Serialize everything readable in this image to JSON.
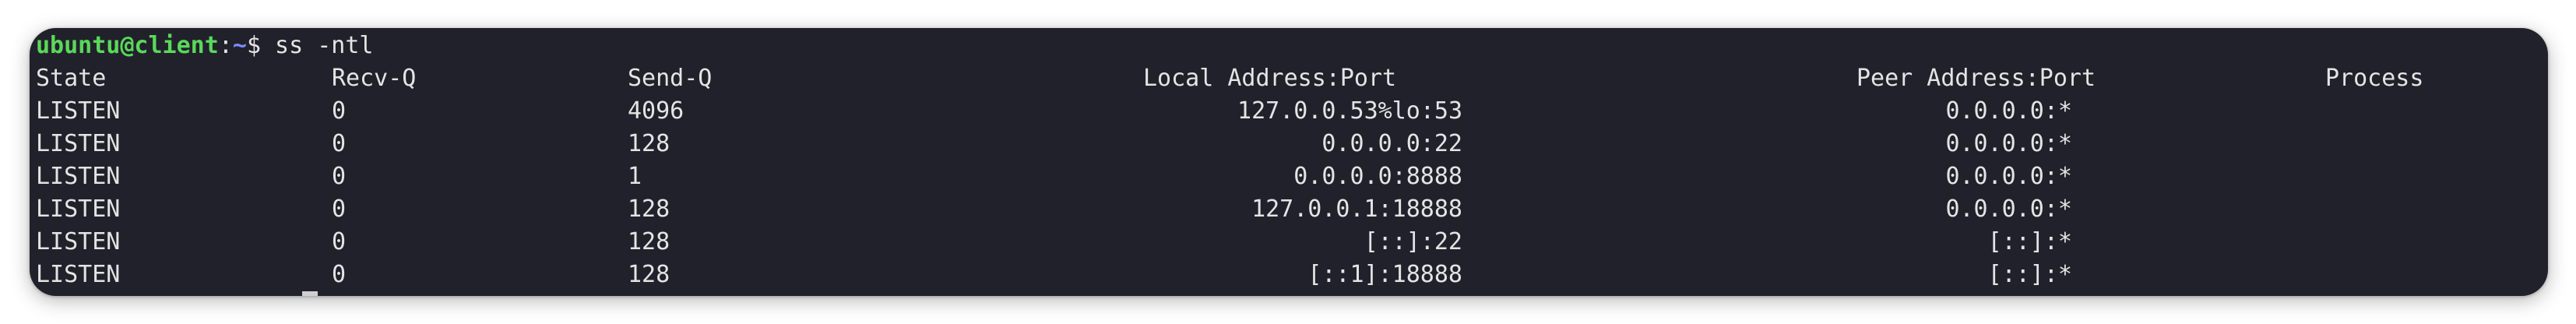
{
  "prompt": {
    "user_host": "ubuntu@client",
    "colon": ":",
    "path": "~",
    "dollar": "$",
    "command": " ss -ntl"
  },
  "table": {
    "headers": {
      "state": "State",
      "recv_q": "Recv-Q",
      "send_q": "Send-Q",
      "local": "Local Address:Port",
      "peer": "Peer Address:Port",
      "process": "Process"
    },
    "rows": [
      {
        "state": "LISTEN",
        "recv_q": "0",
        "send_q": "4096",
        "local": "127.0.0.53%lo:53",
        "peer": "0.0.0.0:*"
      },
      {
        "state": "LISTEN",
        "recv_q": "0",
        "send_q": "128",
        "local": "0.0.0.0:22",
        "peer": "0.0.0.0:*"
      },
      {
        "state": "LISTEN",
        "recv_q": "0",
        "send_q": "1",
        "local": "0.0.0.0:8888",
        "peer": "0.0.0.0:*"
      },
      {
        "state": "LISTEN",
        "recv_q": "0",
        "send_q": "128",
        "local": "127.0.0.1:18888",
        "peer": "0.0.0.0:*"
      },
      {
        "state": "LISTEN",
        "recv_q": "0",
        "send_q": "128",
        "local": "[::]:22",
        "peer": "[::]:*"
      },
      {
        "state": "LISTEN",
        "recv_q": "0",
        "send_q": "128",
        "local": "[::1]:18888",
        "peer": "[::]:*"
      }
    ]
  },
  "colors": {
    "background": "#21212b",
    "user_host": "#5ad85a",
    "path": "#7b8cff",
    "text": "#e4e4e4"
  }
}
